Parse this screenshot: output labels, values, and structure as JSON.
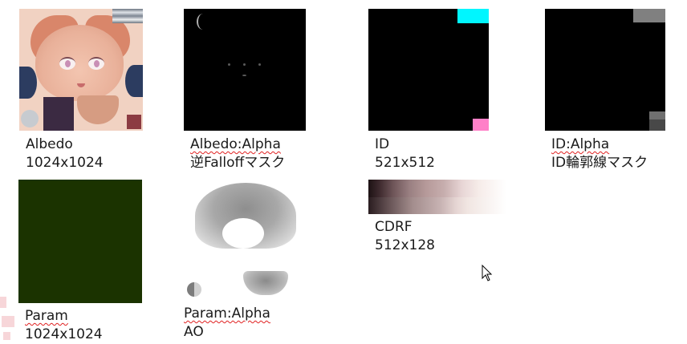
{
  "textures": [
    {
      "name": "Albedo",
      "subtitle": "1024x1024"
    },
    {
      "name": "Albedo:Alpha",
      "subtitle": "逆Falloffマスク"
    },
    {
      "name": "ID",
      "subtitle": "521x512"
    },
    {
      "name": "ID:Alpha",
      "subtitle": "ID輪郭線マスク"
    },
    {
      "name": "Param",
      "subtitle": "1024x1024"
    },
    {
      "name": "Param:Alpha",
      "subtitle": "AO"
    },
    {
      "name": "CDRF",
      "subtitle": "512x128"
    }
  ],
  "colors": {
    "param_fill": "#1b3300",
    "id_cyan": "#00f6ff",
    "id_pink": "#ff80c8",
    "spellcheck_underline": "#e02020"
  },
  "icons": {
    "cursor": "mouse-pointer-icon"
  }
}
